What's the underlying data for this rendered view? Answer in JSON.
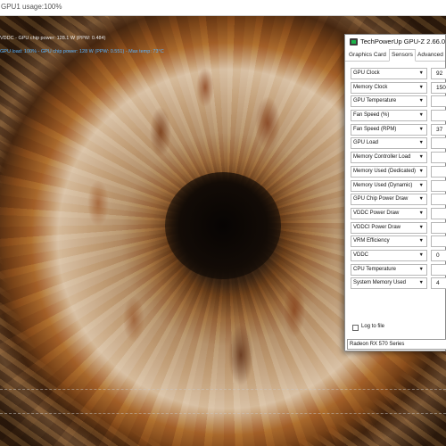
{
  "render_window": {
    "title": "GPU1 usage:100%",
    "osd_line1": "VDDC - GPU chip power: 128.1 W (PPW: 0.484)",
    "osd_line2": "GPU load: 100% - GPU chip power: 128 W (PPW: 0.551) - Max temp: 73°C"
  },
  "gpuz": {
    "window_title": "TechPowerUp GPU-Z 2.66.0",
    "tabs": [
      {
        "label": "Graphics Card",
        "active": false
      },
      {
        "label": "Sensors",
        "active": true
      },
      {
        "label": "Advanced",
        "active": false
      }
    ],
    "sensors": [
      {
        "label": "GPU Clock",
        "value": "92"
      },
      {
        "label": "Memory Clock",
        "value": "150"
      },
      {
        "label": "GPU Temperature",
        "value": ""
      },
      {
        "label": "Fan Speed (%)",
        "value": ""
      },
      {
        "label": "Fan Speed (RPM)",
        "value": "37"
      },
      {
        "label": "GPU Load",
        "value": ""
      },
      {
        "label": "Memory Controller Load",
        "value": ""
      },
      {
        "label": "Memory Used (Dedicated)",
        "value": ""
      },
      {
        "label": "Memory Used (Dynamic)",
        "value": ""
      },
      {
        "label": "GPU Chip Power Draw",
        "value": ""
      },
      {
        "label": "VDDC Power Draw",
        "value": ""
      },
      {
        "label": "VDDCI Power Draw",
        "value": ""
      },
      {
        "label": "VRM Efficiency",
        "value": ""
      },
      {
        "label": "VDDC",
        "value": "0"
      },
      {
        "label": "CPU Temperature",
        "value": ""
      },
      {
        "label": "System Memory Used",
        "value": "4"
      }
    ],
    "dropdown_glyph": "▼",
    "log_to_file_label": "Log to file",
    "log_to_file_checked": false,
    "selected_gpu": "Radeon RX 570 Series"
  }
}
